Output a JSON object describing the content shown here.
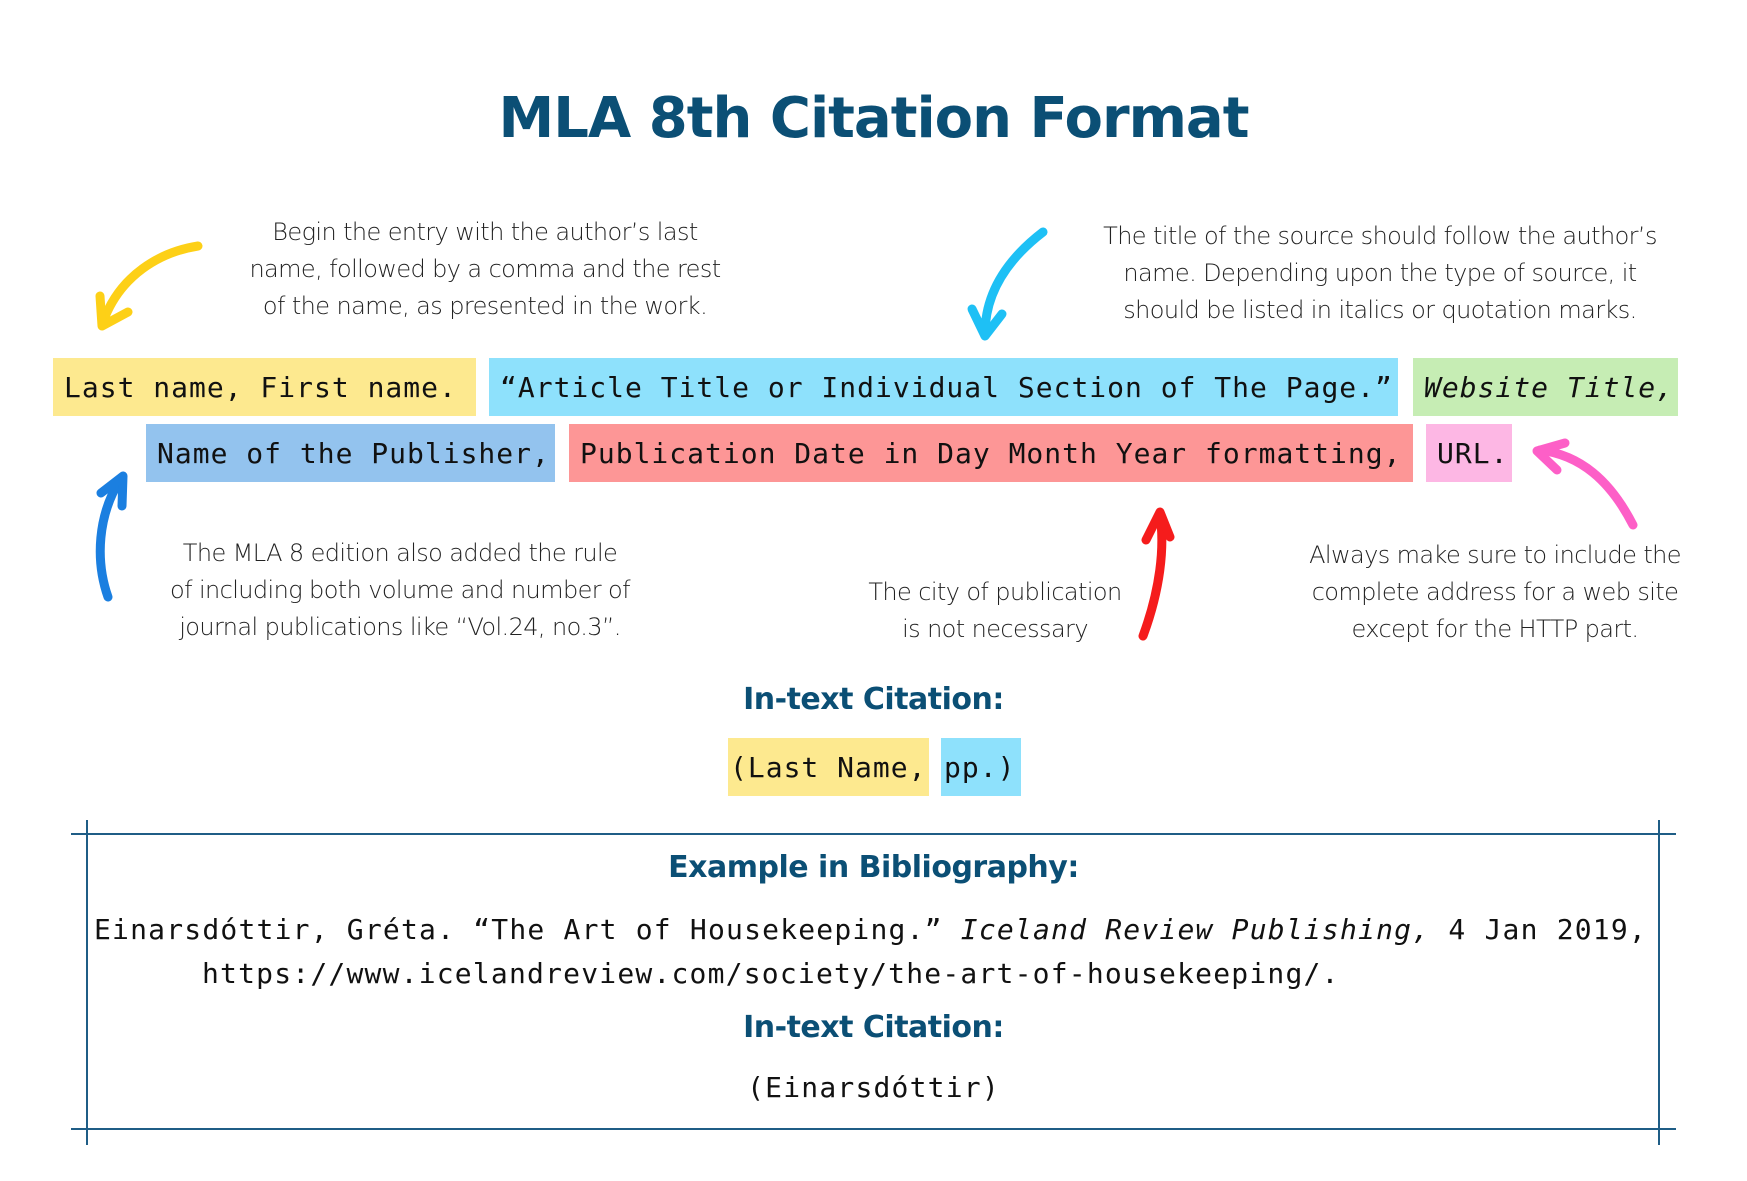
{
  "title": "MLA 8th Citation Format",
  "notes": {
    "author": [
      "Begin the entry with the author’s last",
      "name, followed by a comma and the rest",
      "of the name, as presented in the work."
    ],
    "title": [
      "The title of the source should follow the author’s",
      "name. Depending upon the type of source, it",
      "should be listed in italics or quotation marks."
    ],
    "volume": [
      "The MLA 8 edition also added the rule",
      "of including both volume and number of",
      "journal publications like “Vol.24, no.3”."
    ],
    "city": [
      "The city of publication",
      "is not necessary"
    ],
    "url": [
      "Always make sure to include the",
      "complete address for a web site",
      "except for the HTTP part."
    ]
  },
  "citation_format": {
    "row1": [
      {
        "text": "Last name, First name.",
        "color": "#fde98f",
        "italic": false
      },
      {
        "text": "“Article Title or Individual Section of The Page.”",
        "color": "#8ee1fc",
        "italic": false
      },
      {
        "text": "Website Title,",
        "color": "#c6edb4",
        "italic": true
      }
    ],
    "row2": [
      {
        "text": "Name of the Publisher,",
        "color": "#93c3ee",
        "italic": false
      },
      {
        "text": "Publication Date in Day Month Year formatting,",
        "color": "#fd9696",
        "italic": false
      },
      {
        "text": "URL.",
        "color": "#fdb7e4",
        "italic": false
      }
    ]
  },
  "in_text": {
    "heading": "In-text Citation:",
    "parts": [
      {
        "text": "(Last Name,",
        "color": "#fde98f"
      },
      {
        "text": "pp.)",
        "color": "#8ee1fc"
      }
    ]
  },
  "example": {
    "heading": "Example in Bibliography:",
    "line1_author": "Einarsdóttir, Gréta.",
    "line1_title": "“The Art of Housekeeping.”",
    "line1_publisher": "Iceland Review Publishing,",
    "line1_date": "4 Jan 2019,",
    "line2_url": "https://www.icelandreview.com/society/the-art-of-housekeeping/.",
    "in_text_heading": "In-text Citation:",
    "in_text_value": "(Einarsdóttir)"
  },
  "arrows": {
    "author": {
      "icon": "curved-arrow-icon",
      "color": "#fdd017"
    },
    "title": {
      "icon": "curved-arrow-icon",
      "color": "#1ec0f5"
    },
    "volume": {
      "icon": "curved-arrow-icon",
      "color": "#1b7fe0"
    },
    "city": {
      "icon": "curved-arrow-icon",
      "color": "#f51c1c"
    },
    "url": {
      "icon": "curved-arrow-icon",
      "color": "#fd5fc7"
    }
  },
  "accent_color": "#0b4f75"
}
